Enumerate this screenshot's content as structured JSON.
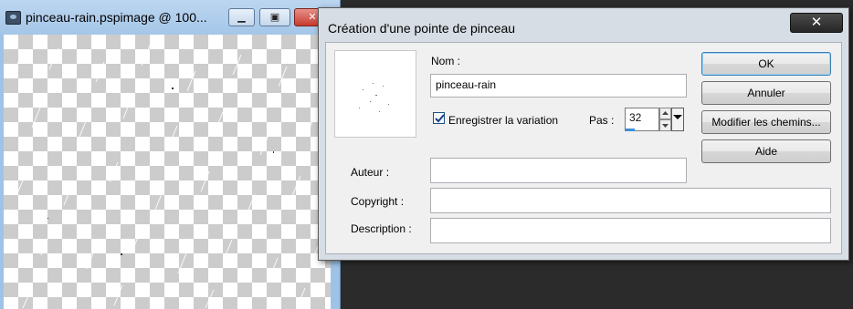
{
  "document_window": {
    "title": "pinceau-rain.pspimage @ 100...",
    "icon": "paintshop-app-icon",
    "buttons": {
      "minimize": "minimize-icon",
      "maximize": "maximize-icon",
      "close": "close-icon"
    }
  },
  "dialog": {
    "title": "Création d'une pointe de pinceau",
    "close_glyph": "✕",
    "fields": {
      "name_label": "Nom :",
      "name_value": "pinceau-rain",
      "save_variation_label": "Enregistrer la variation",
      "save_variation_checked": true,
      "step_label": "Pas :",
      "step_value": "32",
      "author_label": "Auteur :",
      "author_value": "",
      "copyright_label": "Copyright :",
      "copyright_value": "",
      "description_label": "Description :",
      "description_value": ""
    },
    "buttons": {
      "ok": "OK",
      "cancel": "Annuler",
      "modify_paths": "Modifier les chemins...",
      "help": "Aide"
    }
  },
  "colors": {
    "dialog_bg": "#d7dde4",
    "client_bg": "#f0f0f0",
    "window_frame": "#9fc3e6",
    "desktop": "#2b2b2b"
  }
}
